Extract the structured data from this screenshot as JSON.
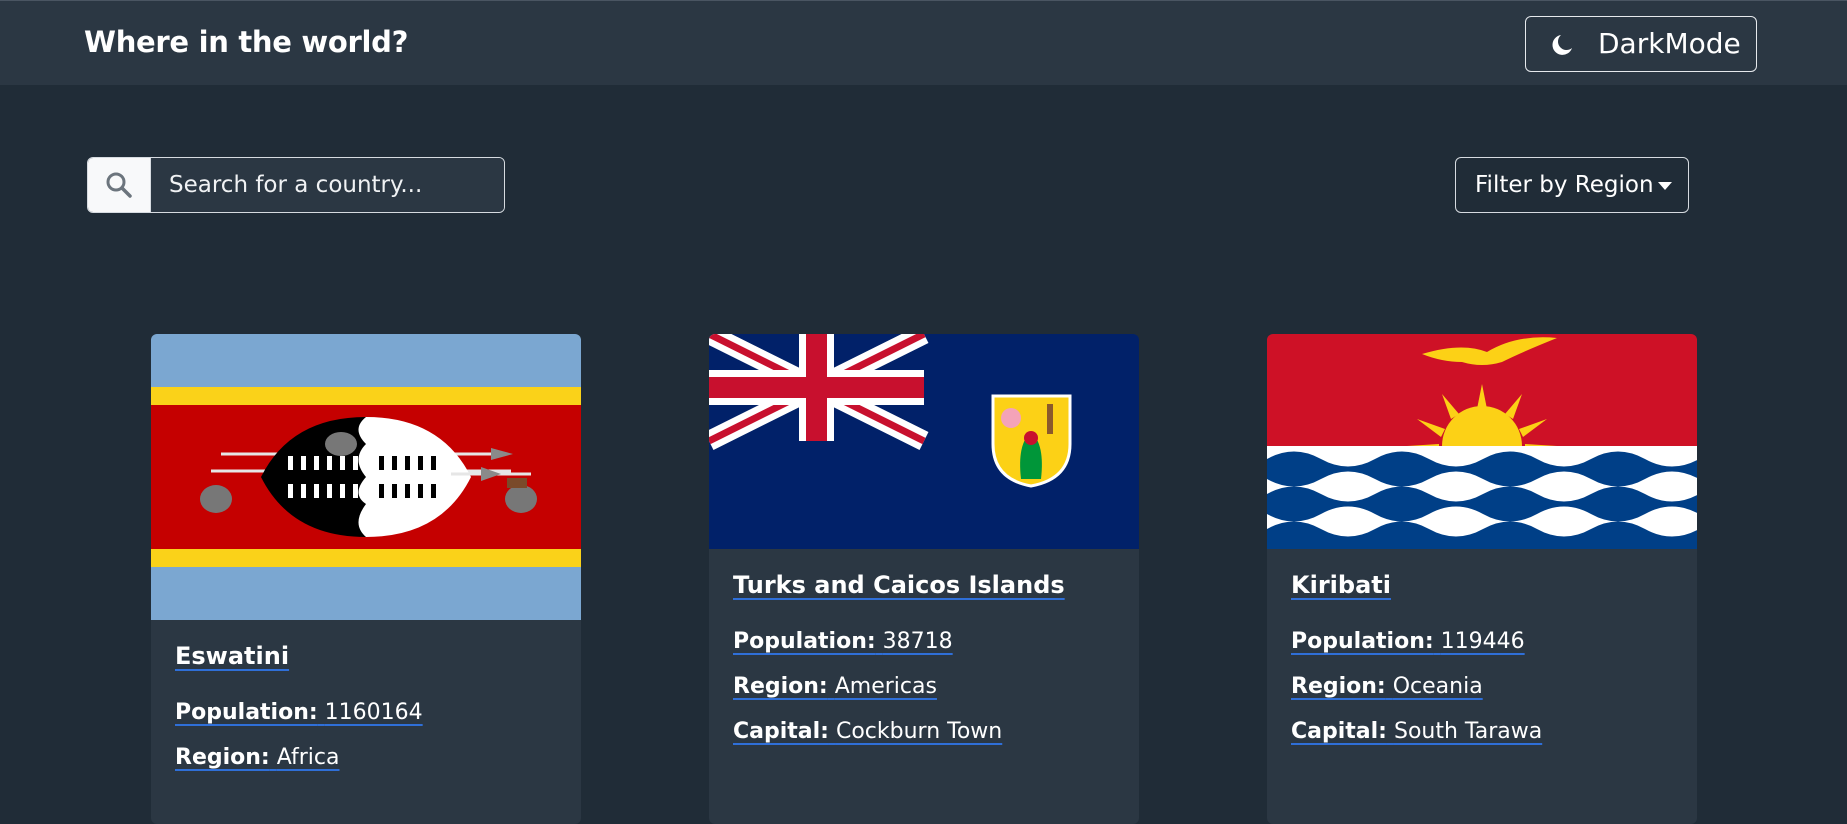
{
  "header": {
    "title": "Where in the world?",
    "dark_mode_label": "DarkMode"
  },
  "search": {
    "placeholder": "Search for a country..."
  },
  "filter": {
    "label": "Filter by Region"
  },
  "labels": {
    "population": "Population:",
    "region": "Region:",
    "capital": "Capital:"
  },
  "countries": [
    {
      "name": "Eswatini",
      "population": "1160164",
      "region": "Africa",
      "capital": ""
    },
    {
      "name": "Turks and Caicos Islands",
      "population": "38718",
      "region": "Americas",
      "capital": "Cockburn Town"
    },
    {
      "name": "Kiribati",
      "population": "119446",
      "region": "Oceania",
      "capital": "South Tarawa"
    }
  ],
  "colors": {
    "background": "#202c37",
    "elements": "#2b3743",
    "link_underline": "#2f6fd8"
  }
}
